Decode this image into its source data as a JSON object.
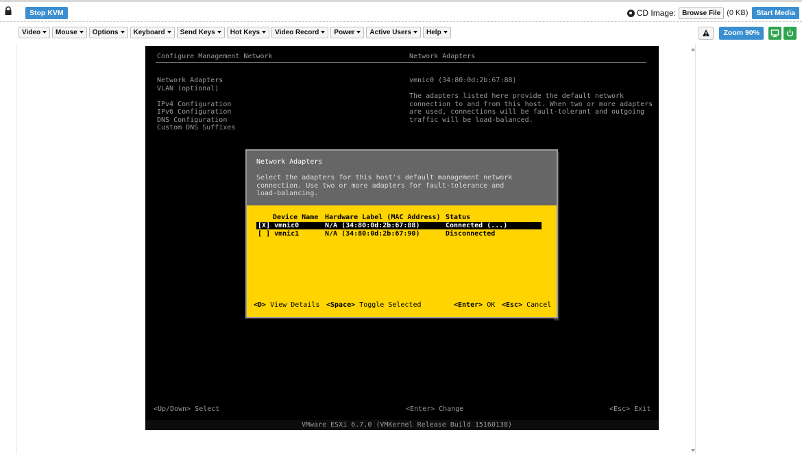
{
  "toolbar": {
    "stop_kvm": "Stop KVM",
    "cd_image_label": "CD Image:",
    "browse_file": "Browse File",
    "file_size": "(0 KB)",
    "start_media": "Start Media"
  },
  "menu": {
    "items": [
      "Video",
      "Mouse",
      "Options",
      "Keyboard",
      "Send Keys",
      "Hot Keys",
      "Video Record",
      "Power",
      "Active Users",
      "Help"
    ],
    "zoom": "Zoom 90%"
  },
  "console": {
    "left_title": "Configure Management Network",
    "right_title": "Network Adapters",
    "left_menu": [
      "Network Adapters",
      "VLAN (optional)",
      "",
      "IPv4 Configuration",
      "IPv6 Configuration",
      "DNS Configuration",
      "Custom DNS Suffixes"
    ],
    "right_adapter": "vmnic0 (34:80:0d:2b:67:88)",
    "right_desc": [
      "The adapters listed here provide the default network",
      "connection to and from this host. When two or more adapters",
      "are used, connections will be fault-tolerant and outgoing",
      "traffic will be load-balanced."
    ],
    "bottom_left": "<Up/Down> Select",
    "bottom_center": "<Enter> Change",
    "bottom_right": "<Esc> Exit",
    "footer": "VMware ESXi 6.7.0 (VMKernel Release Build 15160138)"
  },
  "dialog": {
    "title": "Network Adapters",
    "desc": [
      "Select the adapters for this host's default management network",
      "connection. Use two or more adapters for fault-tolerance and",
      "load-balancing."
    ],
    "col_device": "Device Name",
    "col_hw": "Hardware Label (MAC Address)",
    "col_status": "Status",
    "rows": [
      {
        "sel": "[X] vmnic0",
        "hw": "N/A (34:80:0d:2b:67:88)",
        "status": "Connected (...)"
      },
      {
        "sel": "[ ] vmnic1",
        "hw": "N/A (34:80:0d:2b:67:90)",
        "status": "Disconnected"
      }
    ],
    "key_d": "<D>",
    "key_d_label": "View Details",
    "key_space": "<Space>",
    "key_space_label": "Toggle Selected",
    "key_enter": "<Enter>",
    "key_enter_label": "OK",
    "key_esc": "<Esc>",
    "key_esc_label": "Cancel"
  }
}
